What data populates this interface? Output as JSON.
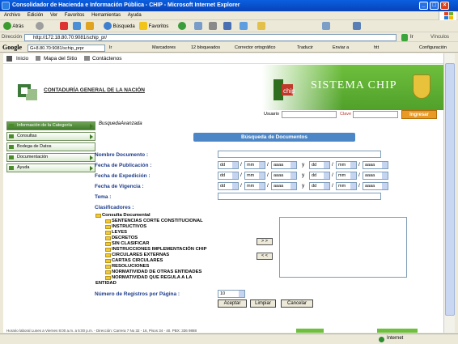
{
  "window": {
    "title": "Consolidador de Hacienda e Información Pública - CHIP - Microsoft Internet Explorer"
  },
  "menubar": [
    "Archivo",
    "Edición",
    "Ver",
    "Favoritos",
    "Herramientas",
    "Ayuda"
  ],
  "toolbar": {
    "back": "Atrás",
    "search": "Búsqueda",
    "favorites": "Favoritos"
  },
  "address": {
    "label": "Dirección",
    "url": "http://172.18.80.70:9081/schip_pr/",
    "go": "Ir",
    "links": "Vínculos"
  },
  "google_bar": {
    "logo": "Google",
    "search_value": "G+8.80.70:9081/schip_prpr",
    "go": "Ir",
    "bookmarks": "Marcadores",
    "blocked": "12 bloqueados",
    "spell": "Corrector ortográfico",
    "translate": "Traducir",
    "send": "Enviar a",
    "htt": "htt",
    "settings": "Configuración"
  },
  "site_nav": {
    "home": "Inicio",
    "sitemap": "Mapa del Sitio",
    "contact": "Contáctenos"
  },
  "header": {
    "org_name": "CONTADURÍA GENERAL DE LA NACIÓN",
    "system_name": "SISTEMA CHIP"
  },
  "login": {
    "user_label": "Usuario",
    "password_label": "Clave",
    "submit": "Ingresar"
  },
  "sidebar": {
    "items": [
      {
        "label": "Información de la Categoría",
        "active": true
      },
      {
        "label": "Consultas",
        "active": false
      },
      {
        "label": "Bodega de Datos",
        "active": false
      },
      {
        "label": "Documentación",
        "active": false
      },
      {
        "label": "Ayuda",
        "active": false
      }
    ]
  },
  "breadcrumb": "BusquedaAvanzada",
  "form": {
    "title": "Búsqueda de Documentos",
    "name_label": "Nombre Documento :",
    "pub_label": "Fecha de Publicación :",
    "exp_label": "Fecha de Expedición :",
    "vig_label": "Fecha de Vigencia :",
    "topic_label": "Tema :",
    "class_label": "Clasificadores :",
    "date_day": "dd",
    "date_month": "mm",
    "date_year": "aaaa",
    "date_sep": "/",
    "range_sep": "y",
    "records_label": "Número de Registros por Página :",
    "records_value": "10",
    "move_right": "> >",
    "move_left": "< <",
    "accept": "Aceptar",
    "clear": "Limpiar",
    "cancel": "Cancelar"
  },
  "tree": {
    "root": "Consulta Documental",
    "nodes": [
      "SENTENCIAS CORTE CONSTITUCIONAL",
      "INSTRUCTIVOS",
      "LEYES",
      "DECRETOS",
      "SIN CLASIFICAR",
      "INSTRUCCIONES IMPLEMENTACIÓN CHIP",
      "CIRCULARES EXTERNAS",
      "CARTAS CIRCULARES",
      "RESOLUCIONES",
      "NORMATIVIDAD DE OTRAS ENTIDADES",
      "NORMATIVIDAD QUE REGULA A LA"
    ],
    "last_line": "ENTIDAD"
  },
  "footer": {
    "text": "Horario laboral Lunes a Viernes 8:00 a.m. a 5:00 p.m. - Dirección: Carrera 7 No 32 - 16, Pisos 34 - 40. PBX: 336 9888"
  },
  "status": {
    "zone": "Internet"
  },
  "colors": {
    "ie_blue": "#0a5fe0",
    "chip_green": "#4c9c28",
    "form_label_blue": "#1d3c8a",
    "form_header": "#4c86c6",
    "login_button": "#e89a25"
  }
}
